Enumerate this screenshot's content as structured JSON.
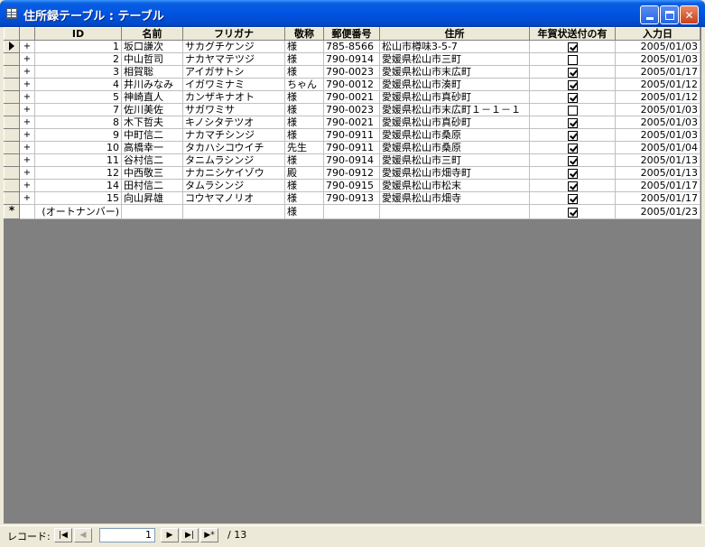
{
  "window": {
    "title": "住所録テーブル : テーブル",
    "icon": "datasheet-icon"
  },
  "columns": [
    "ID",
    "名前",
    "フリガナ",
    "敬称",
    "郵便番号",
    "住所",
    "年賀状送付の有",
    "入力日"
  ],
  "rows": [
    {
      "id": "1",
      "name": "坂口謙次",
      "kana": "サカグチケンジ",
      "honorific": "様",
      "zip": "785-8566",
      "address": "松山市樽味3-5-7",
      "nenga": true,
      "date": "2005/01/03"
    },
    {
      "id": "2",
      "name": "中山哲司",
      "kana": "ナカヤマテツジ",
      "honorific": "様",
      "zip": "790-0914",
      "address": "愛媛県松山市三町",
      "nenga": false,
      "date": "2005/01/03"
    },
    {
      "id": "3",
      "name": "相賀聡",
      "kana": "アイガサトシ",
      "honorific": "様",
      "zip": "790-0023",
      "address": "愛媛県松山市末広町",
      "nenga": true,
      "date": "2005/01/17"
    },
    {
      "id": "4",
      "name": "井川みなみ",
      "kana": "イガワミナミ",
      "honorific": "ちゃん",
      "zip": "790-0012",
      "address": "愛媛県松山市湊町",
      "nenga": true,
      "date": "2005/01/12"
    },
    {
      "id": "5",
      "name": "神崎直人",
      "kana": "カンザキナオト",
      "honorific": "様",
      "zip": "790-0021",
      "address": "愛媛県松山市真砂町",
      "nenga": true,
      "date": "2005/01/12"
    },
    {
      "id": "7",
      "name": "佐川美佐",
      "kana": "サガワミサ",
      "honorific": "様",
      "zip": "790-0023",
      "address": "愛媛県松山市末広町１－１－１",
      "nenga": false,
      "date": "2005/01/03"
    },
    {
      "id": "8",
      "name": "木下哲夫",
      "kana": "キノシタテツオ",
      "honorific": "様",
      "zip": "790-0021",
      "address": "愛媛県松山市真砂町",
      "nenga": true,
      "date": "2005/01/03"
    },
    {
      "id": "9",
      "name": "中町信二",
      "kana": "ナカマチシンジ",
      "honorific": "様",
      "zip": "790-0911",
      "address": "愛媛県松山市桑原",
      "nenga": true,
      "date": "2005/01/03"
    },
    {
      "id": "10",
      "name": "高橋幸一",
      "kana": "タカハシコウイチ",
      "honorific": "先生",
      "zip": "790-0911",
      "address": "愛媛県松山市桑原",
      "nenga": true,
      "date": "2005/01/04"
    },
    {
      "id": "11",
      "name": "谷村信二",
      "kana": "タニムラシンジ",
      "honorific": "様",
      "zip": "790-0914",
      "address": "愛媛県松山市三町",
      "nenga": true,
      "date": "2005/01/13"
    },
    {
      "id": "12",
      "name": "中西敬三",
      "kana": "ナカニシケイゾウ",
      "honorific": "殿",
      "zip": "790-0912",
      "address": "愛媛県松山市畑寺町",
      "nenga": true,
      "date": "2005/01/13"
    },
    {
      "id": "14",
      "name": "田村信二",
      "kana": "タムラシンジ",
      "honorific": "様",
      "zip": "790-0915",
      "address": "愛媛県松山市松末",
      "nenga": true,
      "date": "2005/01/17"
    },
    {
      "id": "15",
      "name": "向山昇雄",
      "kana": "コウヤマノリオ",
      "honorific": "様",
      "zip": "790-0913",
      "address": "愛媛県松山市畑寺",
      "nenga": true,
      "date": "2005/01/17"
    }
  ],
  "new_row": {
    "id_placeholder": "(オートナンバー)",
    "honorific": "様",
    "nenga": true,
    "date": "2005/01/23"
  },
  "nav": {
    "label": "レコード:",
    "current": "1",
    "total": "/ 13",
    "first_icon": "first-record-icon",
    "prev_icon": "prev-record-icon",
    "next_icon": "next-record-icon",
    "last_icon": "last-record-icon",
    "new_icon": "new-record-icon"
  },
  "colors": {
    "titlebar": "#0054e3",
    "chrome": "#ece9d8",
    "workspace": "#808080"
  }
}
